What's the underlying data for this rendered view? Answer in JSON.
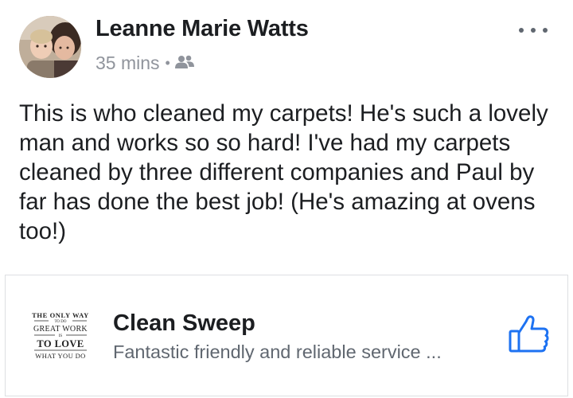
{
  "post": {
    "author": "Leanne Marie Watts",
    "time": "35 mins",
    "separator": "•",
    "audience_icon": "friends-icon",
    "more_icon": "more-options-icon",
    "text": "This is who cleaned my carpets! He's such a lovely man and works so so hard! I've had my carpets cleaned by three different companies and Paul by far has done the best job! (He's amazing at ovens too!)"
  },
  "page_card": {
    "logo_lines": [
      "THE ONLY WAY",
      "TO DO",
      "GREAT WORK",
      "IS",
      "TO LOVE",
      "WHAT YOU DO"
    ],
    "name": "Clean Sweep",
    "description": "Fantastic friendly and reliable service ...",
    "like_icon": "thumbs-up-icon"
  },
  "colors": {
    "text_primary": "#1c1e21",
    "text_secondary": "#90949c",
    "description": "#606770",
    "like_blue": "#1d72f2",
    "border": "#dddfe2"
  }
}
